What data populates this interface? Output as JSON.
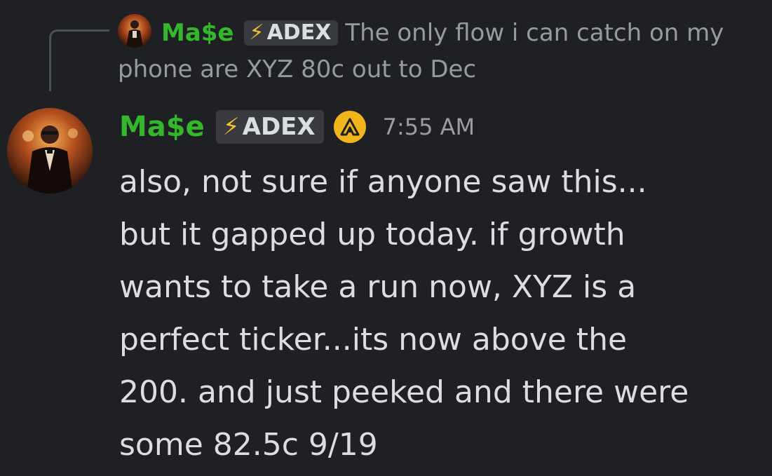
{
  "reply": {
    "username": "Ma$e",
    "tag_icon": "lightning-bolt-icon",
    "tag_label": "ADEX",
    "text": "The only flow i can catch on my phone are XYZ 80c out to Dec"
  },
  "message": {
    "username": "Ma$e",
    "tag_icon": "lightning-bolt-icon",
    "tag_label": "ADEX",
    "badge_icon": "triangle-a-badge-icon",
    "timestamp": "7:55 AM",
    "lines": [
      "also, not sure if anyone saw this...",
      "but it gapped up today. if growth",
      "wants to take a run now, XYZ is a",
      "perfect ticker...its now above the",
      "200. and just peeked and there were",
      "some 82.5c 9/19"
    ]
  },
  "colors": {
    "background": "#1f2024",
    "username": "#34b82b",
    "tag_bg": "#383a40",
    "bolt": "#f2c12e",
    "badge": "#f0b51a",
    "muted_text": "#989aa2",
    "body_text": "#dcdde0"
  }
}
